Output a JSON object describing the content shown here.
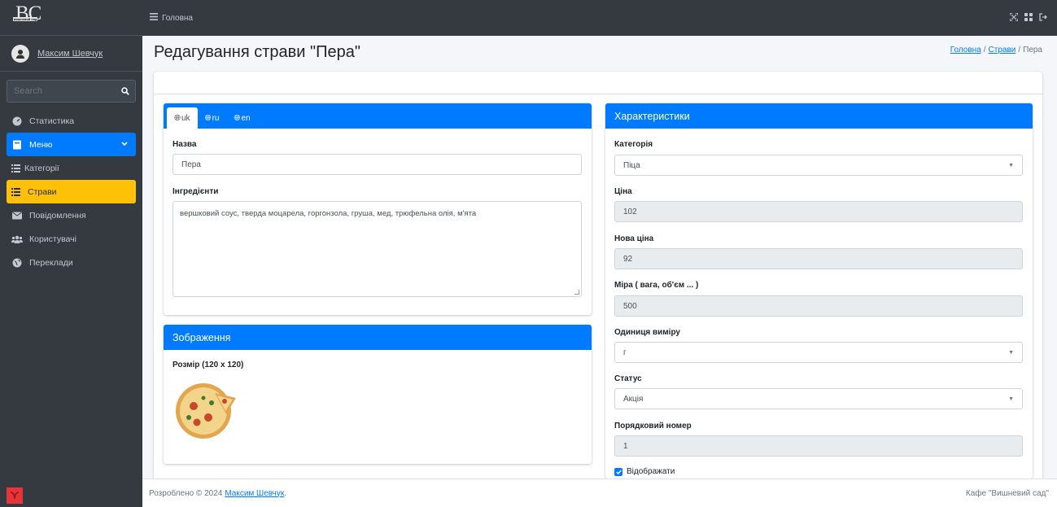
{
  "brand": {
    "logo_letters": "BC",
    "logo_sub": "вишневий сад"
  },
  "user": {
    "name": "Максим Шевчук"
  },
  "search": {
    "placeholder": "Search"
  },
  "sidebar": {
    "items": [
      {
        "label": "Статистика",
        "icon": "tachometer-icon"
      },
      {
        "label": "Меню",
        "icon": "book-icon"
      },
      {
        "label": "Категорії",
        "icon": "list-icon"
      },
      {
        "label": "Страви",
        "icon": "list-icon"
      },
      {
        "label": "Повідомлення",
        "icon": "envelope-icon"
      },
      {
        "label": "Користувачі",
        "icon": "users-icon"
      },
      {
        "label": "Переклади",
        "icon": "globe-icon"
      }
    ]
  },
  "topbar": {
    "crumb": "Головна"
  },
  "page": {
    "title": "Редагування страви \"Пера\""
  },
  "breadcrumb": {
    "home": "Головна",
    "dishes": "Страви",
    "current": "Пера",
    "sep": "/"
  },
  "tabs": [
    {
      "label": "uk"
    },
    {
      "label": "ru"
    },
    {
      "label": "en"
    }
  ],
  "form": {
    "name_label": "Назва",
    "name_value": "Пера",
    "ingredients_label": "Інгредієнти",
    "ingredients_value": "вершковий соус, тверда моцарела, горгонзола, груша, мед, трюфельна олія, м'ята"
  },
  "image_card": {
    "title": "Зображення",
    "size_label": "Розмір (120 x 120)"
  },
  "specs": {
    "title": "Характеристики",
    "category_label": "Категорія",
    "category_value": "Піца",
    "price_label": "Ціна",
    "price_value": "102",
    "new_price_label": "Нова ціна",
    "new_price_value": "92",
    "measure_label": "Міра ( вага, об'єм ... )",
    "measure_value": "500",
    "unit_label": "Одиниця виміру",
    "unit_value": "г",
    "status_label": "Статус",
    "status_value": "Акція",
    "order_label": "Порядковий номер",
    "order_value": "1",
    "display_label": "Відображати"
  },
  "footer": {
    "text": "Розроблено © 2024",
    "author": "Максим Шевчук",
    "dot": ".",
    "right": "Кафе \"Вишневий сад\""
  },
  "colors": {
    "primary": "#007bff",
    "warning": "#ffc107",
    "sidebar": "#343a40"
  }
}
